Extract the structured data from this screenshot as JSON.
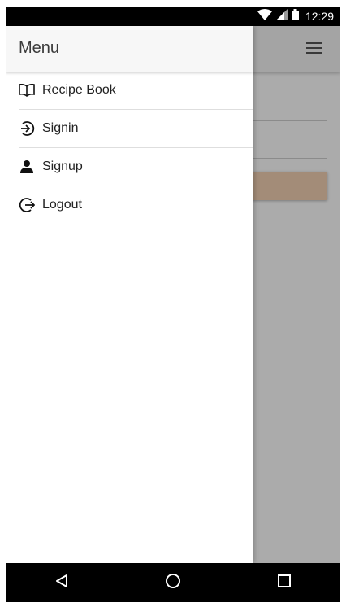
{
  "status_bar": {
    "time": "12:29",
    "icons": [
      "wifi-icon",
      "signal-icon",
      "battery-icon"
    ]
  },
  "drawer": {
    "title": "Menu",
    "items": [
      {
        "label": "Recipe Book",
        "icon": "book-icon"
      },
      {
        "label": "Signin",
        "icon": "signin-icon"
      },
      {
        "label": "Signup",
        "icon": "person-icon"
      },
      {
        "label": "Logout",
        "icon": "logout-icon"
      }
    ]
  },
  "nav_bar": {
    "buttons": [
      "back-icon",
      "home-icon",
      "recents-icon"
    ]
  },
  "colors": {
    "status_bar": "#000000",
    "drawer_header": "#f7f7f7",
    "scrim": "rgba(0,0,0,0.33)",
    "bg_button": "#f3d1b3"
  }
}
